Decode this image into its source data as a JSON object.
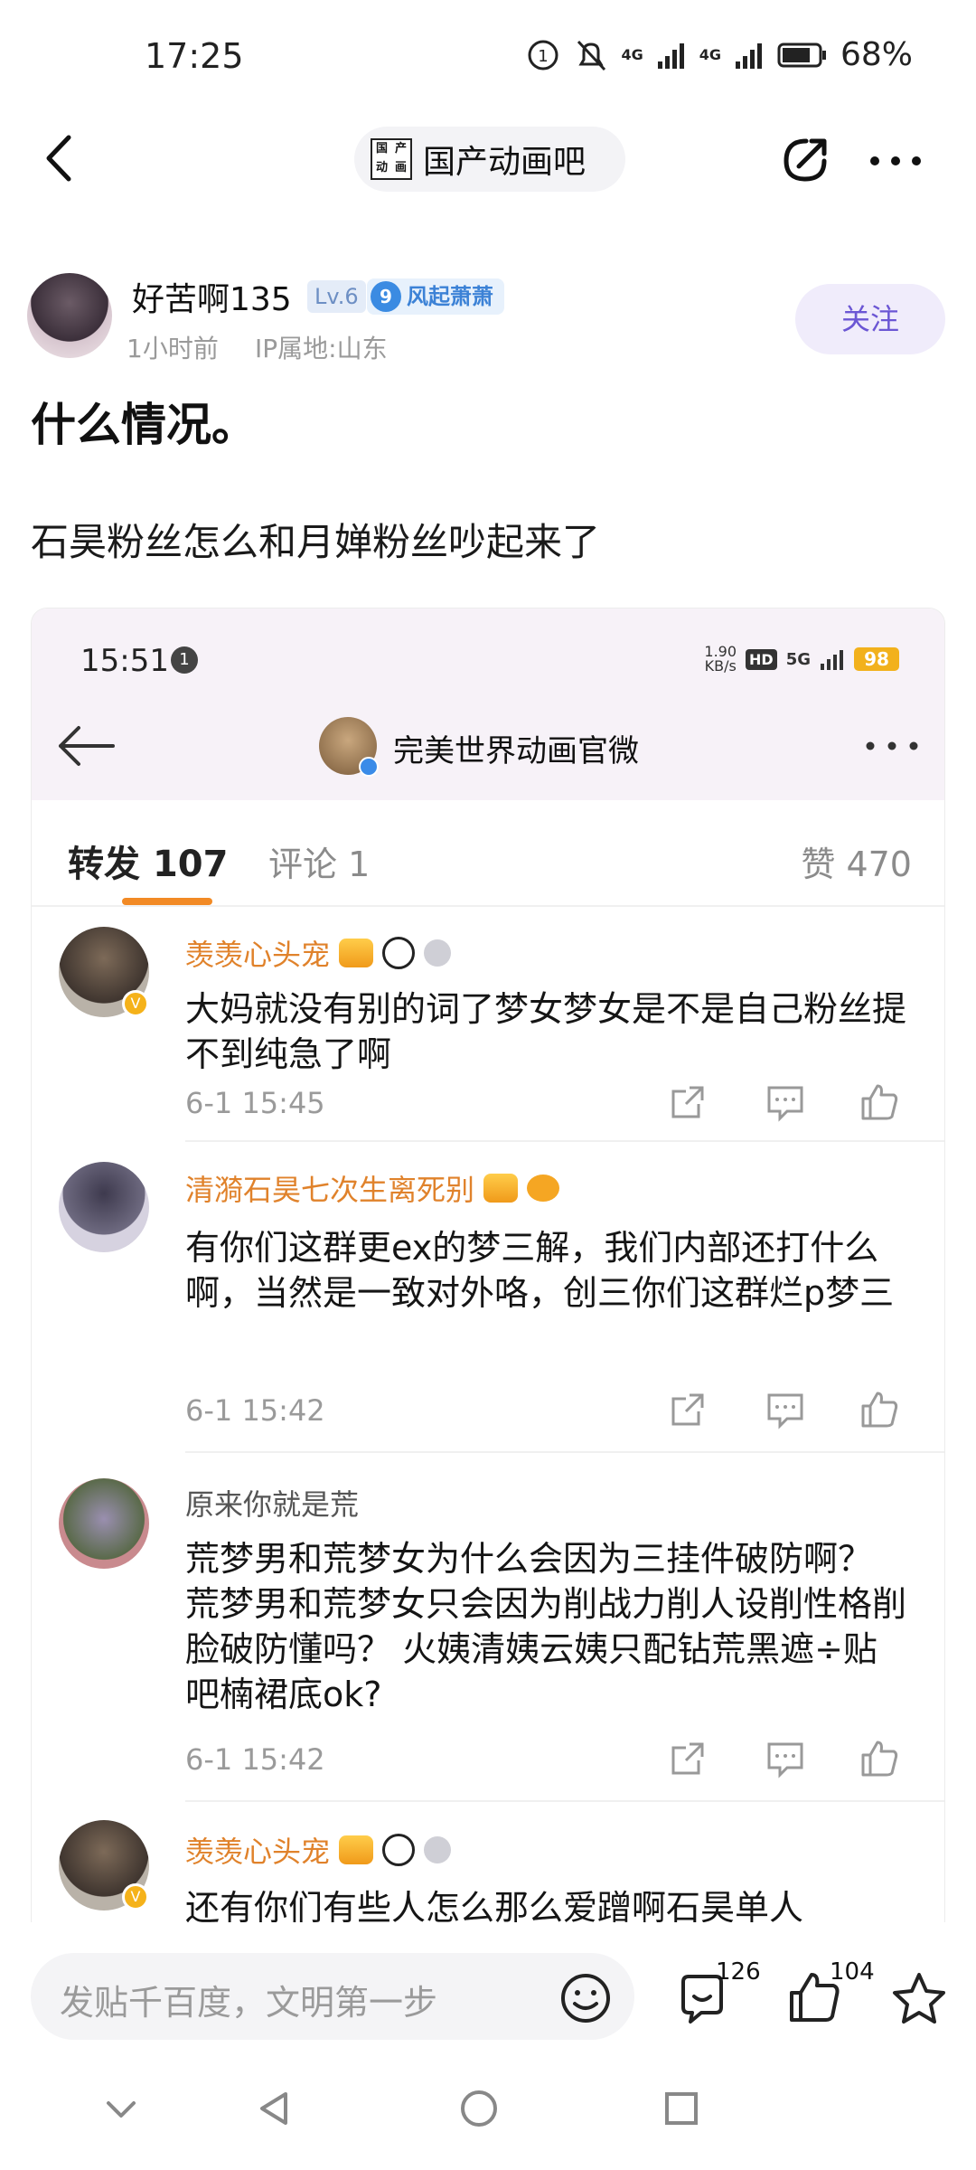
{
  "status_bar": {
    "time": "17:25",
    "signal1": "4G",
    "signal2": "4G",
    "battery": "68%"
  },
  "nav": {
    "forum_name": "国产动画吧",
    "forum_logo": [
      "国",
      "产",
      "动",
      "画"
    ]
  },
  "post": {
    "author": "好苦啊135",
    "level": "Lv.6",
    "title_badge_level": "9",
    "title_badge": "风起萧萧",
    "time": "1小时前",
    "ip": "IP属地:山东",
    "follow_label": "关注",
    "title": "什么情况。",
    "body": "石昊粉丝怎么和月婵粉丝吵起来了"
  },
  "screenshot": {
    "status_time": "15:51",
    "status_dot": "1",
    "net_speed_value": "1.90",
    "net_speed_unit": "KB/s",
    "hd": "HD",
    "five_g": "5G",
    "battery": "98",
    "account": "完美世界动画官微",
    "tabs": {
      "repost_label": "转发",
      "repost_count": "107",
      "comment_label": "评论 1",
      "like_label": "赞 470"
    },
    "comments": [
      {
        "name": "羡羡心头宠",
        "text": "大妈就没有别的词了梦女梦女是不是自己粉丝提不到纯急了啊",
        "date": "6-1 15:45"
      },
      {
        "name": "清漪石昊七次生离死别",
        "text": "有你们这群更ex的梦三解，我们内部还打什么啊，当然是一致对外咯，创三你们这群烂p梦三",
        "date": "6-1 15:42"
      },
      {
        "name": "原来你就是荒",
        "text": "荒梦男和荒梦女为什么会因为三挂件破防啊？ 荒梦男和荒梦女只会因为削战力削人设削性格削脸破防懂吗？ 火姨清姨云姨只配钻荒黑遮÷贴吧楠裙底ok?",
        "date": "6-1 15:42"
      },
      {
        "name": "羡羡心头宠",
        "text": "还有你们有些人怎么那么爱蹭啊石昊单人"
      }
    ]
  },
  "bottom_bar": {
    "input_placeholder": "发贴千百度，文明第一步",
    "comment_count": "126",
    "like_count": "104"
  }
}
